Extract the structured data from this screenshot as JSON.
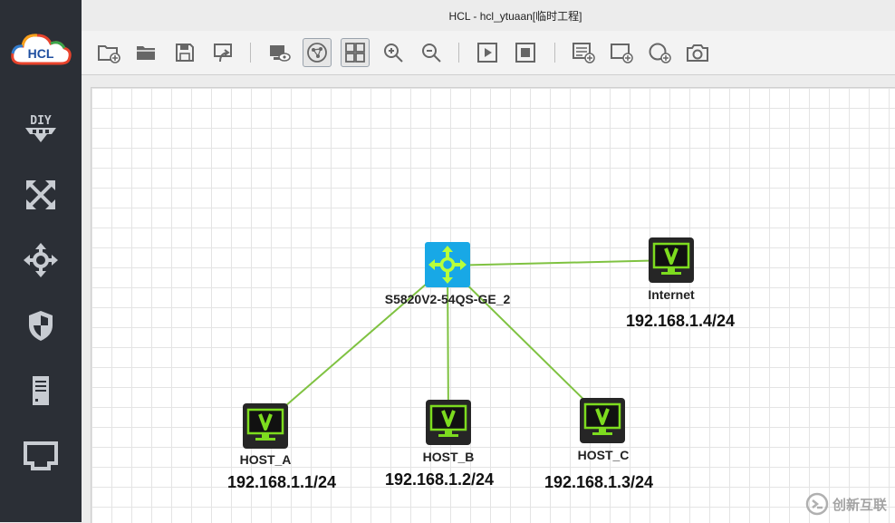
{
  "window": {
    "title": "HCL - hcl_ytuaan[临时工程]"
  },
  "logo": {
    "text": "HCL"
  },
  "sidebar": {
    "items": [
      {
        "name": "diy",
        "label": "DIY"
      },
      {
        "name": "router"
      },
      {
        "name": "switch"
      },
      {
        "name": "firewall"
      },
      {
        "name": "server"
      },
      {
        "name": "terminal"
      }
    ]
  },
  "toolbar": {
    "buttons": [
      "new-project",
      "open-project",
      "save",
      "export",
      "show-interface",
      "topology-overview",
      "grid",
      "zoom-in",
      "zoom-out",
      "start-all",
      "stop-all",
      "add-text",
      "add-rectangle",
      "add-ellipse",
      "screenshot"
    ]
  },
  "topology": {
    "switch": {
      "label": "S5820V2-54QS-GE_2"
    },
    "hosts": [
      {
        "id": "internet",
        "label": "Internet",
        "ip": "192.168.1.4/24"
      },
      {
        "id": "host_a",
        "label": "HOST_A",
        "ip": "192.168.1.1/24"
      },
      {
        "id": "host_b",
        "label": "HOST_B",
        "ip": "192.168.1.2/24"
      },
      {
        "id": "host_c",
        "label": "HOST_C",
        "ip": "192.168.1.3/24"
      }
    ]
  },
  "watermark": {
    "text": "创新互联"
  },
  "colors": {
    "sidebar_bg": "#2b2f36",
    "link": "#7fc241",
    "switch": "#18a8e6",
    "host_screen": "#7ddc1f"
  }
}
